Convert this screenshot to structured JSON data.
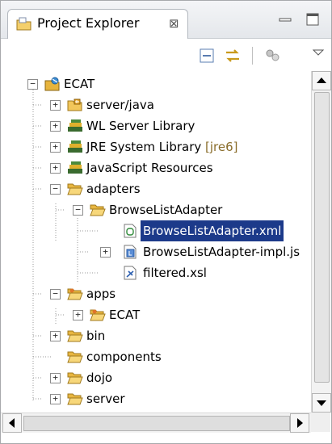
{
  "view": {
    "title": "Project Explorer",
    "close_glyph": "⊠",
    "icon": "project-explorer-icon"
  },
  "window_controls": [
    "minimize-icon",
    "maximize-icon"
  ],
  "toolbar": {
    "buttons": [
      "collapse-all-icon",
      "link-with-editor-icon",
      "focus-on-working-set-icon",
      "view-menu-icon"
    ]
  },
  "tree": {
    "root": "ECAT",
    "items": [
      {
        "label": "server/java"
      },
      {
        "label": "WL Server Library"
      },
      {
        "label": "JRE System Library",
        "suffix": "[jre6]"
      },
      {
        "label": "JavaScript Resources"
      },
      {
        "label": "adapters"
      },
      {
        "label": "BrowseListAdapter"
      },
      {
        "label": "BrowseListAdapter.xml"
      },
      {
        "label": "BrowseListAdapter-impl.js"
      },
      {
        "label": "filtered.xsl"
      },
      {
        "label": "apps"
      },
      {
        "label": "ECAT"
      },
      {
        "label": "bin"
      },
      {
        "label": "components"
      },
      {
        "label": "dojo"
      },
      {
        "label": "server"
      }
    ]
  },
  "colors": {
    "selection": "#1c3a8a",
    "folder": "#f2c65a",
    "library": "#3a6b2f"
  }
}
